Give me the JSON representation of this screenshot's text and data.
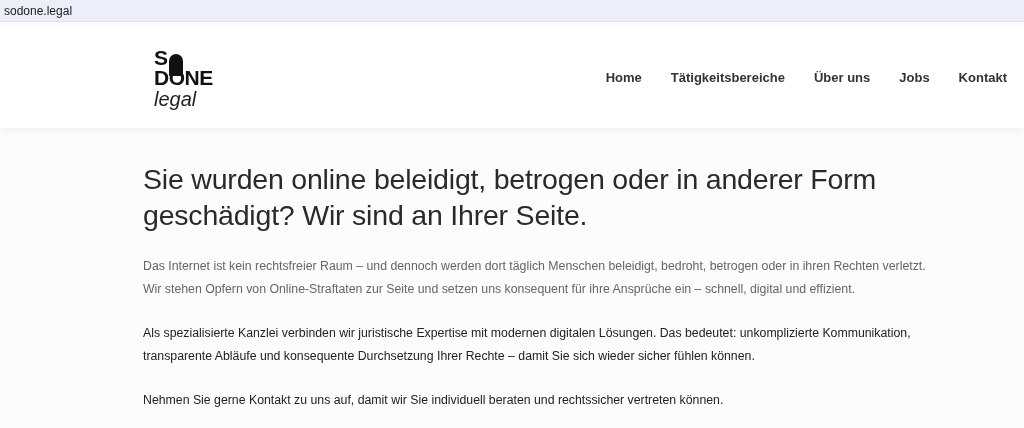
{
  "address_bar": {
    "url": "sodone.legal"
  },
  "logo": {
    "top": "S",
    "middle": "DONE",
    "bottom": "legal"
  },
  "nav": [
    {
      "label": "Home"
    },
    {
      "label": "Tätigkeitsbereiche"
    },
    {
      "label": "Über uns"
    },
    {
      "label": "Jobs"
    },
    {
      "label": "Kontakt"
    }
  ],
  "heading": [
    "Sie wurden online beleidigt, betrogen oder in anderer Form",
    "geschädigt? Wir sind an Ihrer Seite."
  ],
  "paragraphs": [
    [
      "Das Internet ist kein rechtsfreier Raum – und dennoch werden dort täglich Menschen beleidigt, bedroht, betrogen oder in ihren Rechten verletzt.",
      "Wir stehen Opfern von Online-Straftaten zur Seite und setzen uns konsequent für ihre Ansprüche ein – schnell, digital und effizient."
    ],
    [
      "Als spezialisierte Kanzlei verbinden wir juristische Expertise mit modernen digitalen Lösungen. Das bedeutet: unkomplizierte Kommunikation,",
      "transparente Abläufe und konsequente Durchsetzung Ihrer Rechte – damit Sie sich wieder sicher fühlen können."
    ],
    [
      "Nehmen Sie gerne Kontakt zu uns auf, damit wir Sie individuell beraten und rechtssicher vertreten können."
    ]
  ]
}
